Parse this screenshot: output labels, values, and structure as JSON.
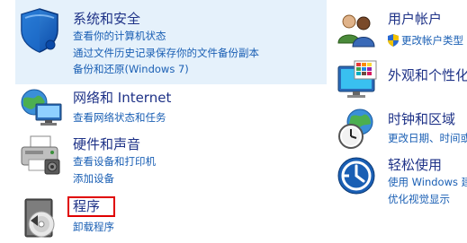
{
  "left": {
    "system": {
      "title": "系统和安全",
      "links": [
        "查看你的计算机状态",
        "通过文件历史记录保存你的文件备份副本",
        "备份和还原(Windows 7)"
      ]
    },
    "network": {
      "title": "网络和 Internet",
      "links": [
        "查看网络状态和任务"
      ]
    },
    "hardware": {
      "title": "硬件和声音",
      "links": [
        "查看设备和打印机",
        "添加设备"
      ]
    },
    "programs": {
      "title": "程序",
      "links": [
        "卸载程序"
      ]
    }
  },
  "right": {
    "users": {
      "title": "用户帐户",
      "links": [
        "更改帐户类型"
      ]
    },
    "appearance": {
      "title": "外观和个性化",
      "links": []
    },
    "clock": {
      "title": "时钟和区域",
      "links": [
        "更改日期、时间或数"
      ]
    },
    "ease": {
      "title": "轻松使用",
      "links": [
        "使用 Windows 建",
        "优化视觉显示"
      ]
    }
  },
  "colors": {
    "title": "#1e3287",
    "link": "#1a5fb4",
    "highlight_bg": "#e5f1fb",
    "red_box": "#e00000"
  }
}
